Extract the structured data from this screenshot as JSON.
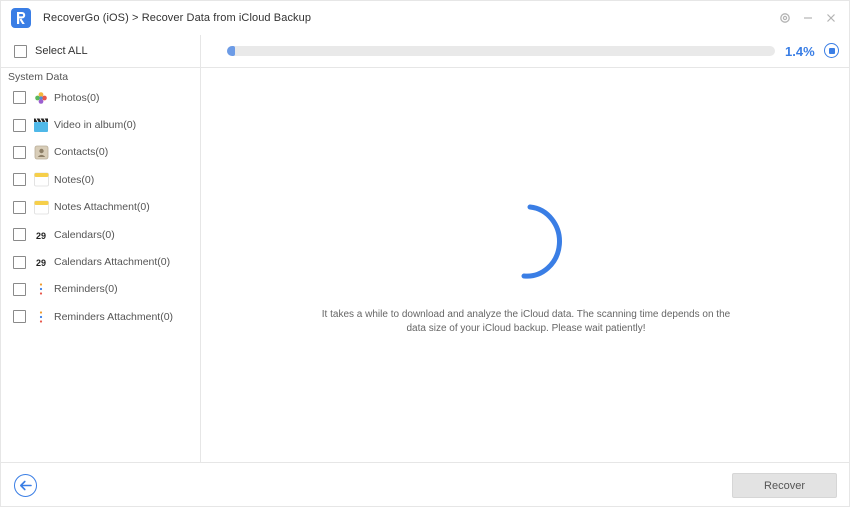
{
  "titlebar": {
    "app_name": "RecoverGo (iOS)",
    "separator": " > ",
    "page": "Recover Data from iCloud Backup",
    "logo_letter": "R",
    "brand_color": "#3a7ee5"
  },
  "sidebar": {
    "select_all_label": "Select ALL",
    "section_label": "System Data",
    "items": [
      {
        "label": "Photos(0)",
        "icon": "photos-icon"
      },
      {
        "label": "Video in album(0)",
        "icon": "video-clapper-icon"
      },
      {
        "label": "Contacts(0)",
        "icon": "contacts-icon"
      },
      {
        "label": "Notes(0)",
        "icon": "notes-icon"
      },
      {
        "label": "Notes Attachment(0)",
        "icon": "notes-attachment-icon"
      },
      {
        "label": "Calendars(0)",
        "icon": "calendar-icon",
        "icon_text": "29"
      },
      {
        "label": "Calendars Attachment(0)",
        "icon": "calendar-attachment-icon",
        "icon_text": "29"
      },
      {
        "label": "Reminders(0)",
        "icon": "reminders-icon"
      },
      {
        "label": "Reminders Attachment(0)",
        "icon": "reminders-attachment-icon"
      }
    ]
  },
  "progress": {
    "percent_label": "1.4%",
    "fraction": 0.014
  },
  "main": {
    "message_line1": "It takes a while to download and analyze the iCloud data. The scanning time depends on the",
    "message_line2": "data size of your iCloud backup. Please wait patiently!"
  },
  "footer": {
    "recover_label": "Recover"
  }
}
